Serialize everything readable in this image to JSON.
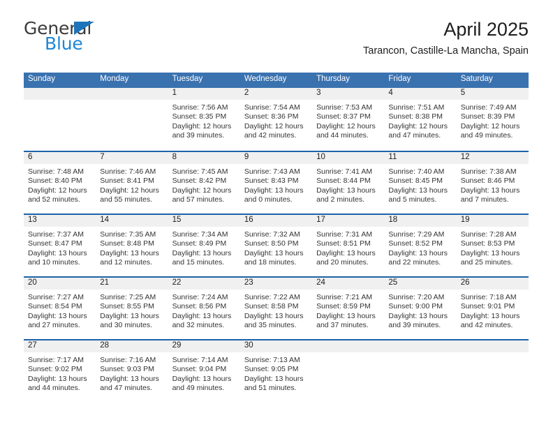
{
  "brand": {
    "name_top": "General",
    "name_bottom": "Blue",
    "accent_color": "#1e86d6",
    "triangle_color": "#1e74bb"
  },
  "header": {
    "title": "April 2025",
    "subtitle": "Tarancon, Castille-La Mancha, Spain"
  },
  "theme": {
    "header_bar_color": "#3a72b0",
    "row_divider_color": "#1c63a8",
    "day_strip_color": "#f0f0f0",
    "text_color": "#333333"
  },
  "weekdays": [
    "Sunday",
    "Monday",
    "Tuesday",
    "Wednesday",
    "Thursday",
    "Friday",
    "Saturday"
  ],
  "labels": {
    "sunrise": "Sunrise:",
    "sunset": "Sunset:",
    "daylight": "Daylight:"
  },
  "weeks": [
    [
      {
        "day": "",
        "blank": true,
        "sunrise": "",
        "sunset": "",
        "daylight_1": "",
        "daylight_2": ""
      },
      {
        "day": "",
        "blank": true,
        "sunrise": "",
        "sunset": "",
        "daylight_1": "",
        "daylight_2": ""
      },
      {
        "day": "1",
        "blank": false,
        "sunrise": "Sunrise: 7:56 AM",
        "sunset": "Sunset: 8:35 PM",
        "daylight_1": "Daylight: 12 hours",
        "daylight_2": "and 39 minutes."
      },
      {
        "day": "2",
        "blank": false,
        "sunrise": "Sunrise: 7:54 AM",
        "sunset": "Sunset: 8:36 PM",
        "daylight_1": "Daylight: 12 hours",
        "daylight_2": "and 42 minutes."
      },
      {
        "day": "3",
        "blank": false,
        "sunrise": "Sunrise: 7:53 AM",
        "sunset": "Sunset: 8:37 PM",
        "daylight_1": "Daylight: 12 hours",
        "daylight_2": "and 44 minutes."
      },
      {
        "day": "4",
        "blank": false,
        "sunrise": "Sunrise: 7:51 AM",
        "sunset": "Sunset: 8:38 PM",
        "daylight_1": "Daylight: 12 hours",
        "daylight_2": "and 47 minutes."
      },
      {
        "day": "5",
        "blank": false,
        "sunrise": "Sunrise: 7:49 AM",
        "sunset": "Sunset: 8:39 PM",
        "daylight_1": "Daylight: 12 hours",
        "daylight_2": "and 49 minutes."
      }
    ],
    [
      {
        "day": "6",
        "blank": false,
        "sunrise": "Sunrise: 7:48 AM",
        "sunset": "Sunset: 8:40 PM",
        "daylight_1": "Daylight: 12 hours",
        "daylight_2": "and 52 minutes."
      },
      {
        "day": "7",
        "blank": false,
        "sunrise": "Sunrise: 7:46 AM",
        "sunset": "Sunset: 8:41 PM",
        "daylight_1": "Daylight: 12 hours",
        "daylight_2": "and 55 minutes."
      },
      {
        "day": "8",
        "blank": false,
        "sunrise": "Sunrise: 7:45 AM",
        "sunset": "Sunset: 8:42 PM",
        "daylight_1": "Daylight: 12 hours",
        "daylight_2": "and 57 minutes."
      },
      {
        "day": "9",
        "blank": false,
        "sunrise": "Sunrise: 7:43 AM",
        "sunset": "Sunset: 8:43 PM",
        "daylight_1": "Daylight: 13 hours",
        "daylight_2": "and 0 minutes."
      },
      {
        "day": "10",
        "blank": false,
        "sunrise": "Sunrise: 7:41 AM",
        "sunset": "Sunset: 8:44 PM",
        "daylight_1": "Daylight: 13 hours",
        "daylight_2": "and 2 minutes."
      },
      {
        "day": "11",
        "blank": false,
        "sunrise": "Sunrise: 7:40 AM",
        "sunset": "Sunset: 8:45 PM",
        "daylight_1": "Daylight: 13 hours",
        "daylight_2": "and 5 minutes."
      },
      {
        "day": "12",
        "blank": false,
        "sunrise": "Sunrise: 7:38 AM",
        "sunset": "Sunset: 8:46 PM",
        "daylight_1": "Daylight: 13 hours",
        "daylight_2": "and 7 minutes."
      }
    ],
    [
      {
        "day": "13",
        "blank": false,
        "sunrise": "Sunrise: 7:37 AM",
        "sunset": "Sunset: 8:47 PM",
        "daylight_1": "Daylight: 13 hours",
        "daylight_2": "and 10 minutes."
      },
      {
        "day": "14",
        "blank": false,
        "sunrise": "Sunrise: 7:35 AM",
        "sunset": "Sunset: 8:48 PM",
        "daylight_1": "Daylight: 13 hours",
        "daylight_2": "and 12 minutes."
      },
      {
        "day": "15",
        "blank": false,
        "sunrise": "Sunrise: 7:34 AM",
        "sunset": "Sunset: 8:49 PM",
        "daylight_1": "Daylight: 13 hours",
        "daylight_2": "and 15 minutes."
      },
      {
        "day": "16",
        "blank": false,
        "sunrise": "Sunrise: 7:32 AM",
        "sunset": "Sunset: 8:50 PM",
        "daylight_1": "Daylight: 13 hours",
        "daylight_2": "and 18 minutes."
      },
      {
        "day": "17",
        "blank": false,
        "sunrise": "Sunrise: 7:31 AM",
        "sunset": "Sunset: 8:51 PM",
        "daylight_1": "Daylight: 13 hours",
        "daylight_2": "and 20 minutes."
      },
      {
        "day": "18",
        "blank": false,
        "sunrise": "Sunrise: 7:29 AM",
        "sunset": "Sunset: 8:52 PM",
        "daylight_1": "Daylight: 13 hours",
        "daylight_2": "and 22 minutes."
      },
      {
        "day": "19",
        "blank": false,
        "sunrise": "Sunrise: 7:28 AM",
        "sunset": "Sunset: 8:53 PM",
        "daylight_1": "Daylight: 13 hours",
        "daylight_2": "and 25 minutes."
      }
    ],
    [
      {
        "day": "20",
        "blank": false,
        "sunrise": "Sunrise: 7:27 AM",
        "sunset": "Sunset: 8:54 PM",
        "daylight_1": "Daylight: 13 hours",
        "daylight_2": "and 27 minutes."
      },
      {
        "day": "21",
        "blank": false,
        "sunrise": "Sunrise: 7:25 AM",
        "sunset": "Sunset: 8:55 PM",
        "daylight_1": "Daylight: 13 hours",
        "daylight_2": "and 30 minutes."
      },
      {
        "day": "22",
        "blank": false,
        "sunrise": "Sunrise: 7:24 AM",
        "sunset": "Sunset: 8:56 PM",
        "daylight_1": "Daylight: 13 hours",
        "daylight_2": "and 32 minutes."
      },
      {
        "day": "23",
        "blank": false,
        "sunrise": "Sunrise: 7:22 AM",
        "sunset": "Sunset: 8:58 PM",
        "daylight_1": "Daylight: 13 hours",
        "daylight_2": "and 35 minutes."
      },
      {
        "day": "24",
        "blank": false,
        "sunrise": "Sunrise: 7:21 AM",
        "sunset": "Sunset: 8:59 PM",
        "daylight_1": "Daylight: 13 hours",
        "daylight_2": "and 37 minutes."
      },
      {
        "day": "25",
        "blank": false,
        "sunrise": "Sunrise: 7:20 AM",
        "sunset": "Sunset: 9:00 PM",
        "daylight_1": "Daylight: 13 hours",
        "daylight_2": "and 39 minutes."
      },
      {
        "day": "26",
        "blank": false,
        "sunrise": "Sunrise: 7:18 AM",
        "sunset": "Sunset: 9:01 PM",
        "daylight_1": "Daylight: 13 hours",
        "daylight_2": "and 42 minutes."
      }
    ],
    [
      {
        "day": "27",
        "blank": false,
        "sunrise": "Sunrise: 7:17 AM",
        "sunset": "Sunset: 9:02 PM",
        "daylight_1": "Daylight: 13 hours",
        "daylight_2": "and 44 minutes."
      },
      {
        "day": "28",
        "blank": false,
        "sunrise": "Sunrise: 7:16 AM",
        "sunset": "Sunset: 9:03 PM",
        "daylight_1": "Daylight: 13 hours",
        "daylight_2": "and 47 minutes."
      },
      {
        "day": "29",
        "blank": false,
        "sunrise": "Sunrise: 7:14 AM",
        "sunset": "Sunset: 9:04 PM",
        "daylight_1": "Daylight: 13 hours",
        "daylight_2": "and 49 minutes."
      },
      {
        "day": "30",
        "blank": false,
        "sunrise": "Sunrise: 7:13 AM",
        "sunset": "Sunset: 9:05 PM",
        "daylight_1": "Daylight: 13 hours",
        "daylight_2": "and 51 minutes."
      },
      {
        "day": "",
        "blank": true,
        "sunrise": "",
        "sunset": "",
        "daylight_1": "",
        "daylight_2": ""
      },
      {
        "day": "",
        "blank": true,
        "sunrise": "",
        "sunset": "",
        "daylight_1": "",
        "daylight_2": ""
      },
      {
        "day": "",
        "blank": true,
        "sunrise": "",
        "sunset": "",
        "daylight_1": "",
        "daylight_2": ""
      }
    ]
  ]
}
